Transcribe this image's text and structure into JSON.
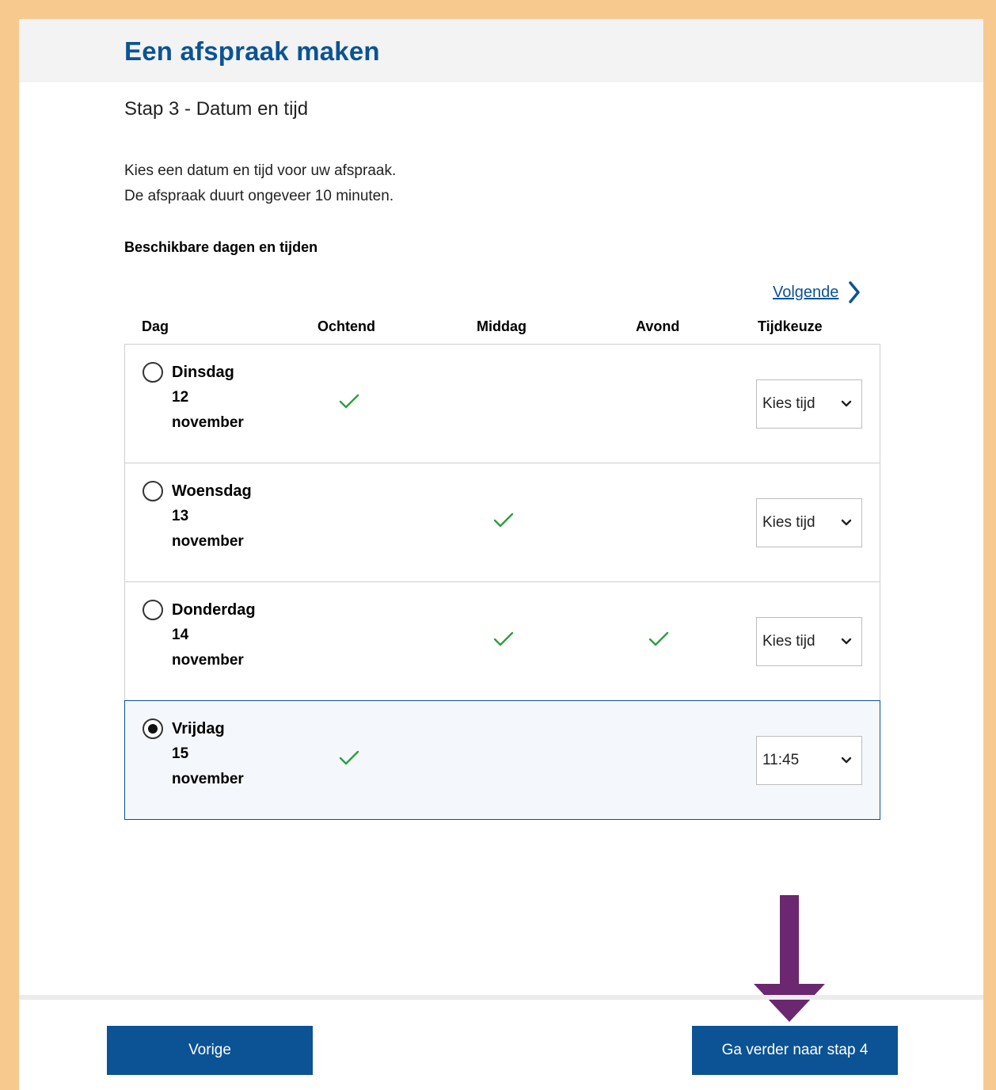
{
  "header": {
    "title": "Een afspraak maken"
  },
  "step": {
    "title": "Stap 3 - Datum en tijd"
  },
  "intro": {
    "line1": "Kies een datum en tijd voor uw afspraak.",
    "line2": "De afspraak duurt ongeveer 10 minuten."
  },
  "section": {
    "heading": "Beschikbare dagen en tijden"
  },
  "nav": {
    "next_label": "Volgende"
  },
  "columns": {
    "day": "Dag",
    "morning": "Ochtend",
    "afternoon": "Middag",
    "evening": "Avond",
    "time_choice": "Tijdkeuze"
  },
  "slots": [
    {
      "day": "Dinsdag",
      "date": "12",
      "month": "november",
      "morning": true,
      "afternoon": false,
      "evening": false,
      "time": "Kies tijd",
      "selected": false
    },
    {
      "day": "Woensdag",
      "date": "13",
      "month": "november",
      "morning": false,
      "afternoon": true,
      "evening": false,
      "time": "Kies tijd",
      "selected": false
    },
    {
      "day": "Donderdag",
      "date": "14",
      "month": "november",
      "morning": false,
      "afternoon": true,
      "evening": true,
      "time": "Kies tijd",
      "selected": false
    },
    {
      "day": "Vrijdag",
      "date": "15",
      "month": "november",
      "morning": true,
      "afternoon": false,
      "evening": false,
      "time": "11:45",
      "selected": true
    }
  ],
  "footer": {
    "prev_label": "Vorige",
    "next_label": "Ga verder naar stap 4"
  },
  "colors": {
    "brand": "#0b5394",
    "check": "#2e9e3f",
    "annotation_arrow": "#6b2770",
    "frame": "#f7c98f"
  },
  "icons": {
    "next": "chevron-right-icon",
    "check": "checkmark-icon",
    "dropdown": "chevron-down-icon",
    "annotation": "arrow-down-icon"
  }
}
